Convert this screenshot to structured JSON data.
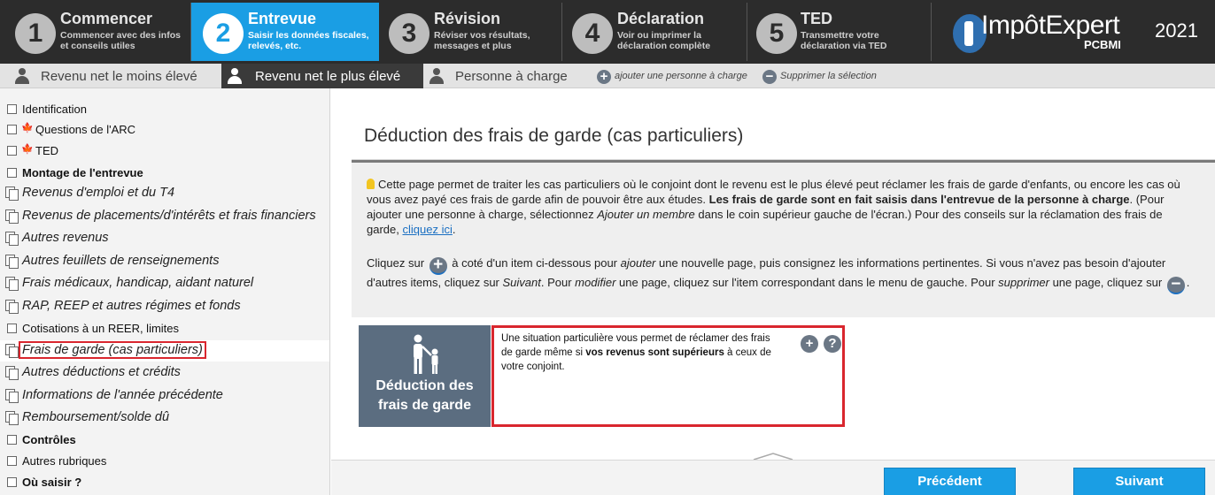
{
  "steps": [
    {
      "num": "1",
      "title": "Commencer",
      "sub1": "Commencer avec des infos",
      "sub2": "et conseils utiles"
    },
    {
      "num": "2",
      "title": "Entrevue",
      "sub1": "Saisir les données fiscales,",
      "sub2": "relevés, etc."
    },
    {
      "num": "3",
      "title": "Révision",
      "sub1": "Réviser vos résultats,",
      "sub2": "messages et plus"
    },
    {
      "num": "4",
      "title": "Déclaration",
      "sub1": "Voir ou imprimer la",
      "sub2": "déclaration complète"
    },
    {
      "num": "5",
      "title": "TED",
      "sub1": "Transmettre votre",
      "sub2": "déclaration via TED"
    }
  ],
  "logo": {
    "name": "ImpôtExpert",
    "sub": "PCBMI",
    "year": "2021"
  },
  "person_tabs": [
    {
      "label": "Revenu net le moins élevé"
    },
    {
      "label": "Revenu net le plus élevé"
    },
    {
      "label": "Personne à charge"
    }
  ],
  "actions": {
    "add_label": "ajouter une personne à charge",
    "remove_label": "Supprimer la sélection",
    "add_glyph": "+",
    "remove_glyph": "−"
  },
  "sidebar": [
    {
      "label": "Identification"
    },
    {
      "label": "Questions de l'ARC",
      "leaf": "🍁"
    },
    {
      "label": "TED",
      "leaf": "🍁"
    },
    {
      "label": "Montage de l'entrevue"
    },
    {
      "label": "Revenus d'emploi et du T4"
    },
    {
      "label": "Revenus de placements/d'intérêts et frais financiers"
    },
    {
      "label": "Autres revenus"
    },
    {
      "label": "Autres feuillets de renseignements"
    },
    {
      "label": "Frais médicaux, handicap, aidant naturel"
    },
    {
      "label": "RAP, REEP et autres régimes et fonds"
    },
    {
      "label": "Cotisations à un REER, limites"
    },
    {
      "label": "Frais de garde (cas particuliers)"
    },
    {
      "label": "Autres déductions et crédits"
    },
    {
      "label": "Informations de l'année précédente"
    },
    {
      "label": "Remboursement/solde dû"
    },
    {
      "label": "Contrôles"
    },
    {
      "label": "Autres rubriques"
    },
    {
      "label": "Où saisir ?"
    }
  ],
  "main": {
    "title": "Déduction des frais de garde (cas particuliers)",
    "info": {
      "p1_a": "Cette page permet de traiter les cas particuliers où le conjoint dont le revenu est le plus élevé peut réclamer les frais de garde d'enfants, ou encore les cas où vous avez payé ces frais de garde afin de pouvoir être aux études. ",
      "p1_bold": "Les frais de garde sont en fait saisis dans l'entrevue de la personne à charge",
      "p1_b": ". (Pour ajouter une personne à charge, sélectionnez ",
      "p1_ital": "Ajouter un membre",
      "p1_c": " dans le coin supérieur gauche de l'écran.) Pour des conseils sur la réclamation des frais de garde, ",
      "p1_link": "cliquez ici",
      "p1_d": ".",
      "p2_a": "Cliquez sur ",
      "p2_b": " à coté d'un item ci-dessous pour ",
      "p2_i1": "ajouter",
      "p2_c": " une nouvelle page, puis consignez les informations pertinentes. Si vous n'avez pas besoin d'ajouter d'autres items, cliquez sur ",
      "p2_i2": "Suivant",
      "p2_d": ". Pour ",
      "p2_i3": "modifier",
      "p2_e": " une page, cliquez sur l'item correspondant dans le menu de gauche. Pour ",
      "p2_i4": "supprimer",
      "p2_f": " une page, cliquez sur ",
      "p2_g": "."
    },
    "card": {
      "tile_line1": "Déduction des",
      "tile_line2": "frais de garde",
      "desc_a": "Une situation particulière vous permet de réclamer des frais de garde même si ",
      "desc_bold": "vos revenus sont supérieurs",
      "desc_b": " à ceux de votre conjoint.",
      "add_glyph": "+",
      "help_glyph": "?"
    }
  },
  "buttons": {
    "prev": "Précédent",
    "next": "Suivant"
  }
}
